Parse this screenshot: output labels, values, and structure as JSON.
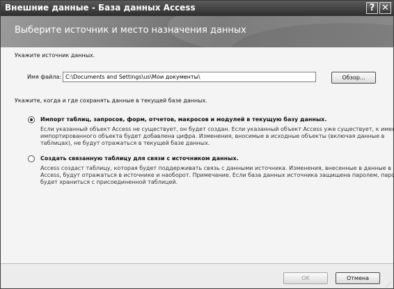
{
  "window": {
    "title": "Внешние данные - База данных Access",
    "help_glyph": "?",
    "close_glyph": "✕"
  },
  "header": {
    "text": "Выберите источник и место назначения данных"
  },
  "source": {
    "label": "Укажите источник данных.",
    "file_label": "Имя файла:",
    "file_value": "C:\\Documents and Settings\\us\\Мои документы\\",
    "browse_label": "Обзор..."
  },
  "storage": {
    "question": "Укажите, когда и где сохранять данные в текущей базе данных.",
    "options": [
      {
        "label": "Импорт таблиц, запросов, форм, отчетов, макросов и модулей в текущую базу данных.",
        "selected": true,
        "desc": [
          "Если указанный объект Access не существует, он будет создан. Если указанный объект Access уже существует, к имени",
          "импортированного объекта будет добавлена цифра. Изменения, вносимые в исходные объекты (включая данные в",
          "таблицах), не будут отражаться в текущей базе данных."
        ]
      },
      {
        "label": "Создать связанную таблицу для связи с источником данных.",
        "selected": false,
        "desc": [
          "Access создаст таблицу, которая будет поддерживать связь с данными источника. Изменения, внесенные в данные в",
          "Access, будут отражаться в источнике и наоборот. Примечание. Если база данных источника защищена паролем, пароль",
          "будет храниться с присоединенной таблицей."
        ]
      }
    ]
  },
  "footer": {
    "ok_label": "OK",
    "cancel_label": "Отмена"
  }
}
